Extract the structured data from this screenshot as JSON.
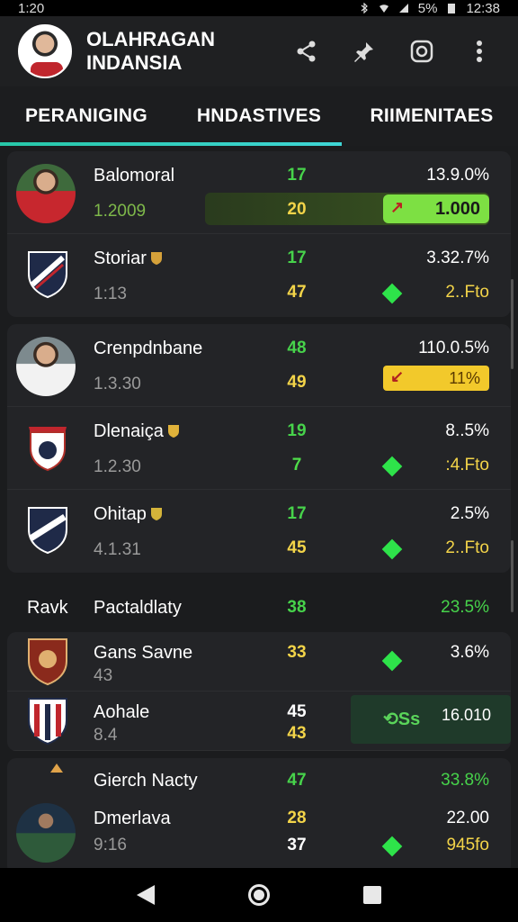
{
  "status": {
    "time_left": "1:20",
    "battery": "5%",
    "time_right": "12:38"
  },
  "app": {
    "title": "OLAHRAGAN\nINDANSIA"
  },
  "icons": {
    "share": "share-icon",
    "pin": "pin-icon",
    "instagram": "instagram-icon",
    "more": "more-icon"
  },
  "tabs": [
    {
      "label": "PERANIGING"
    },
    {
      "label": "HNDASTIVES"
    },
    {
      "label": "RIIMENITAES"
    }
  ],
  "active_tab_fraction": 0.66,
  "cards": [
    {
      "rows": [
        {
          "name": "Balomoral",
          "sub": "1.2009",
          "n1": "17",
          "n2": "20",
          "pct": "13.9.0%",
          "val": "1.000"
        },
        {
          "name": "Storiar",
          "sub": "1:13",
          "n1": "17",
          "n2": "47",
          "pct": "3.32.7%",
          "val": "2..Fto"
        }
      ]
    },
    {
      "rows": [
        {
          "name": "Crenpdnbane",
          "sub": "1.3.30",
          "n1": "48",
          "n2": "49",
          "pct": "110.0.5%",
          "val": "11%"
        },
        {
          "name": "Dlenaiça",
          "sub": "1.2.30",
          "n1": "19",
          "n2": "7",
          "pct": "8..5%",
          "val": ":4.Fto"
        },
        {
          "name": "Ohitap",
          "sub": "4.1.31",
          "n1": "17",
          "n2": "45",
          "pct": "2.5%",
          "val": "2..Fto"
        }
      ]
    }
  ],
  "section": {
    "c1": "Ravk",
    "c2": "Pactaldlaty",
    "c3": "38",
    "c4": "23.5%"
  },
  "compact_rows": [
    {
      "name": "Gans Savne",
      "sub": "43",
      "n1": "33",
      "pct": "3.6%"
    },
    {
      "name": "Aohale",
      "sub": "8.4",
      "n1": "45",
      "n2": "43",
      "highlight_icon": "⟲Ss",
      "highlight_val": "16.010"
    }
  ],
  "last_section": {
    "c2": "Gierch Nacty",
    "c3": "47",
    "c4": "33.8%"
  },
  "last_row": {
    "name": "Dmerlava",
    "sub": "9:16",
    "n1": "28",
    "n2": "37",
    "pct": "22.00",
    "val": "945fo"
  },
  "colors": {
    "accent": "#3fd6d6",
    "green": "#47d34b",
    "yellow": "#f3d449"
  }
}
